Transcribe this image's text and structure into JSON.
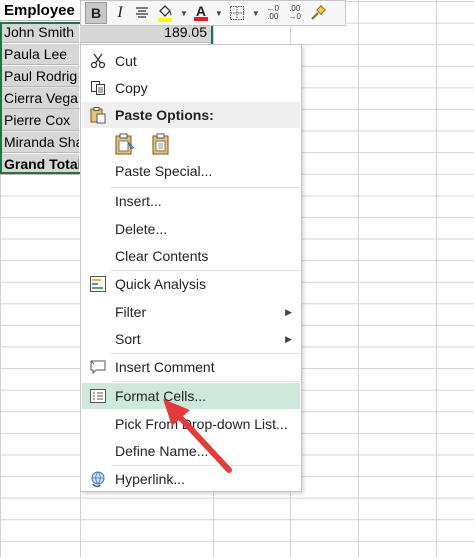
{
  "sheet": {
    "header": "Employee N",
    "rows": [
      {
        "name": "John Smith",
        "value": "189.05"
      },
      {
        "name": "Paula Lee",
        "value": ""
      },
      {
        "name": "Paul Rodrig",
        "value": ""
      },
      {
        "name": "Cierra Vega",
        "value": ""
      },
      {
        "name": "Pierre Cox",
        "value": ""
      },
      {
        "name": "Miranda Sha",
        "value": ""
      },
      {
        "name": "Grand Total",
        "value": ""
      }
    ]
  },
  "toolbar": {
    "bold": "B",
    "italic": "I",
    "font_color_letter": "A",
    "inc_decimal_top": "←0",
    "inc_decimal_bottom": ".00",
    "dec_decimal_top": ".00",
    "dec_decimal_bottom": "→0"
  },
  "menu": {
    "cut": "Cut",
    "copy": "Copy",
    "paste_options": "Paste Options:",
    "paste_special": "Paste Special...",
    "insert": "Insert...",
    "delete": "Delete...",
    "clear_contents": "Clear Contents",
    "quick_analysis": "Quick Analysis",
    "filter": "Filter",
    "sort": "Sort",
    "insert_comment": "Insert Comment",
    "format_cells": "Format Cells...",
    "pick_from_list": "Pick From Drop-down List...",
    "define_name": "Define Name...",
    "hyperlink": "Hyperlink..."
  },
  "colors": {
    "selection_border": "#217346",
    "highlight": "#cfe8dc",
    "annotation_arrow": "#e23c3c"
  }
}
